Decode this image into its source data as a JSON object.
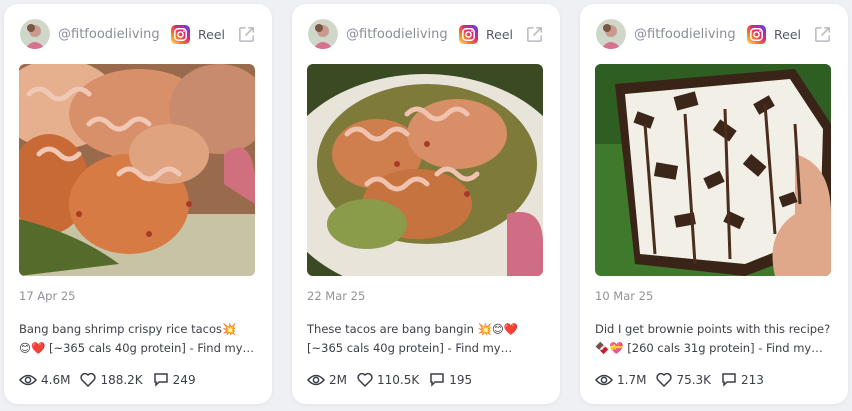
{
  "cards": [
    {
      "handle": "@fitfoodieliving",
      "type_label": "Reel",
      "date": "17 Apr 25",
      "caption_line1": "Bang bang shrimp crispy rice tacos💥",
      "caption_line2": "😊❤️ [~365 cals 40g protein] - Find my…",
      "views": "4.6M",
      "likes": "188.2K",
      "comments": "249"
    },
    {
      "handle": "@fitfoodieliving",
      "type_label": "Reel",
      "date": "22 Mar 25",
      "caption_line1": "These tacos are bang bangin 💥😊❤️",
      "caption_line2": "[~365 cals 40g protein] - Find my…",
      "views": "2M",
      "likes": "110.5K",
      "comments": "195"
    },
    {
      "handle": "@fitfoodieliving",
      "type_label": "Reel",
      "date": "10 Mar 25",
      "caption_line1": "Did I get brownie points with this recipe?",
      "caption_line2": "🍫💝 [260 cals 31g protein] - Find my…",
      "views": "1.7M",
      "likes": "75.3K",
      "comments": "213"
    }
  ],
  "colors": {
    "instagram_gradient": [
      "#feda75",
      "#fa7e1e",
      "#d62976",
      "#962fbf",
      "#4f5bd5"
    ],
    "muted_text": "#8a8d96",
    "body_text": "#3c3f46"
  }
}
